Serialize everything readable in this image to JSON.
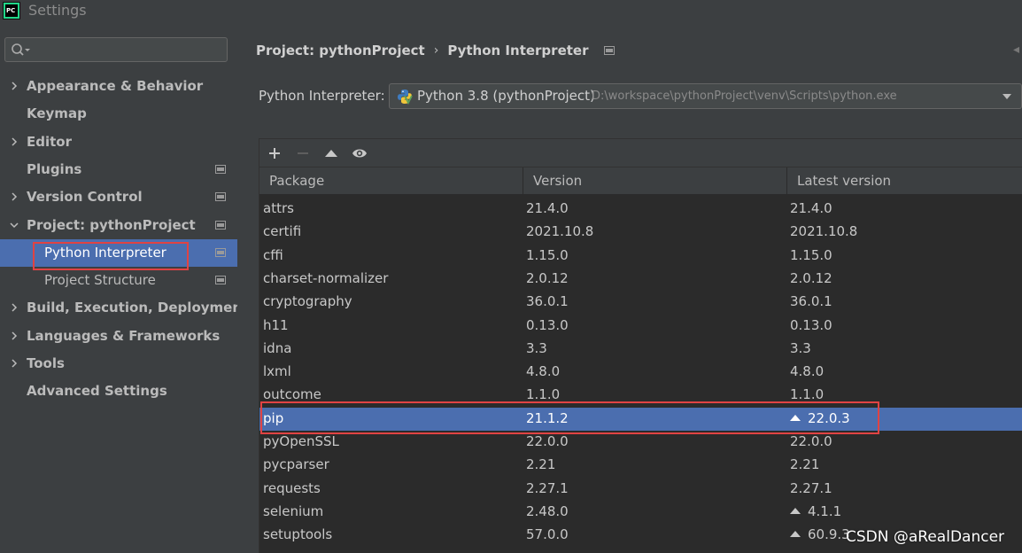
{
  "window": {
    "title": "Settings",
    "app_icon_text": "PC"
  },
  "sidebar": {
    "search_placeholder": "",
    "items": [
      {
        "label": "Appearance & Behavior",
        "expandable": true,
        "expanded": false,
        "settings_icon": false
      },
      {
        "label": "Keymap",
        "expandable": false,
        "settings_icon": false
      },
      {
        "label": "Editor",
        "expandable": true,
        "expanded": false,
        "settings_icon": false
      },
      {
        "label": "Plugins",
        "expandable": false,
        "settings_icon": true
      },
      {
        "label": "Version Control",
        "expandable": true,
        "expanded": false,
        "settings_icon": true
      },
      {
        "label": "Project: pythonProject",
        "expandable": true,
        "expanded": true,
        "settings_icon": true
      },
      {
        "label": "Python Interpreter",
        "sub": true,
        "selected": true,
        "settings_icon": true
      },
      {
        "label": "Project Structure",
        "sub": true,
        "settings_icon": true
      },
      {
        "label": "Build, Execution, Deployment",
        "expandable": true,
        "expanded": false,
        "settings_icon": false
      },
      {
        "label": "Languages & Frameworks",
        "expandable": true,
        "expanded": false,
        "settings_icon": false
      },
      {
        "label": "Tools",
        "expandable": true,
        "expanded": false,
        "settings_icon": false
      },
      {
        "label": "Advanced Settings",
        "expandable": false,
        "settings_icon": false
      }
    ]
  },
  "breadcrumb": {
    "project": "Project: pythonProject",
    "separator": "›",
    "page": "Python Interpreter"
  },
  "interpreter": {
    "label": "Python Interpreter:",
    "name": "Python 3.8 (pythonProject)",
    "path": "D:\\workspace\\pythonProject\\venv\\Scripts\\python.exe"
  },
  "toolbar": {
    "icons": [
      "add-icon",
      "remove-icon",
      "upgrade-icon",
      "show-early-releases-icon"
    ]
  },
  "table": {
    "columns": [
      "Package",
      "Version",
      "Latest version"
    ],
    "rows": [
      {
        "package": "attrs",
        "version": "21.4.0",
        "latest": "21.4.0",
        "upgrade": false
      },
      {
        "package": "certifi",
        "version": "2021.10.8",
        "latest": "2021.10.8",
        "upgrade": false
      },
      {
        "package": "cffi",
        "version": "1.15.0",
        "latest": "1.15.0",
        "upgrade": false
      },
      {
        "package": "charset-normalizer",
        "version": "2.0.12",
        "latest": "2.0.12",
        "upgrade": false
      },
      {
        "package": "cryptography",
        "version": "36.0.1",
        "latest": "36.0.1",
        "upgrade": false
      },
      {
        "package": "h11",
        "version": "0.13.0",
        "latest": "0.13.0",
        "upgrade": false
      },
      {
        "package": "idna",
        "version": "3.3",
        "latest": "3.3",
        "upgrade": false
      },
      {
        "package": "lxml",
        "version": "4.8.0",
        "latest": "4.8.0",
        "upgrade": false
      },
      {
        "package": "outcome",
        "version": "1.1.0",
        "latest": "1.1.0",
        "upgrade": false
      },
      {
        "package": "pip",
        "version": "21.1.2",
        "latest": "22.0.3",
        "upgrade": true,
        "selected": true
      },
      {
        "package": "pyOpenSSL",
        "version": "22.0.0",
        "latest": "22.0.0",
        "upgrade": false
      },
      {
        "package": "pycparser",
        "version": "2.21",
        "latest": "2.21",
        "upgrade": false
      },
      {
        "package": "requests",
        "version": "2.27.1",
        "latest": "2.27.1",
        "upgrade": false
      },
      {
        "package": "selenium",
        "version": "2.48.0",
        "latest": "4.1.1",
        "upgrade": true
      },
      {
        "package": "setuptools",
        "version": "57.0.0",
        "latest": "60.9.3",
        "upgrade": true
      }
    ]
  },
  "watermark": "CSDN @aRealDancer",
  "colors": {
    "background": "#3c3f41",
    "table_bg": "#2b2b2b",
    "selection": "#4b6eaf",
    "highlight_border": "#e04343"
  }
}
